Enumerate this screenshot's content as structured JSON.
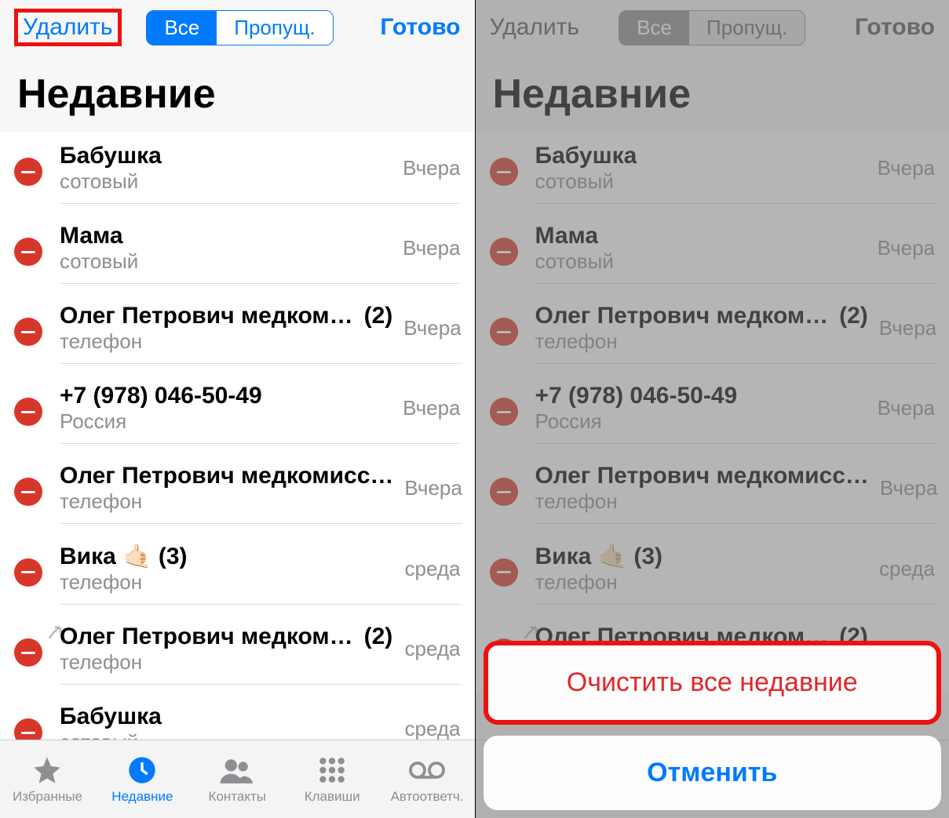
{
  "nav": {
    "delete": "Удалить",
    "done": "Готово",
    "seg_all": "Все",
    "seg_missed": "Пропущ."
  },
  "title": "Недавние",
  "rows": [
    {
      "name": "Бабушка",
      "sub": "сотовый",
      "time": "Вчера",
      "count": "",
      "outgoing": false
    },
    {
      "name": "Мама",
      "sub": "сотовый",
      "time": "Вчера",
      "count": "",
      "outgoing": false
    },
    {
      "name": "Олег Петрович медком…",
      "sub": "телефон",
      "time": "Вчера",
      "count": "(2)",
      "outgoing": false
    },
    {
      "name": "+7 (978) 046-50-49",
      "sub": "Россия",
      "time": "Вчера",
      "count": "",
      "outgoing": false
    },
    {
      "name": "Олег Петрович медкомисс…",
      "sub": "телефон",
      "time": "Вчера",
      "count": "",
      "outgoing": false
    },
    {
      "name": "Вика 🤙🏻 (3)",
      "sub": "телефон",
      "time": "среда",
      "count": "",
      "outgoing": false
    },
    {
      "name": "Олег Петрович медком…",
      "sub": "телефон",
      "time": "среда",
      "count": "(2)",
      "outgoing": true
    },
    {
      "name": "Бабушка",
      "sub": "сотовый",
      "time": "среда",
      "count": "",
      "outgoing": false
    }
  ],
  "tabs": {
    "favorites": "Избранные",
    "recents": "Недавние",
    "contacts": "Контакты",
    "keypad": "Клавиши",
    "voicemail": "Автоответч."
  },
  "sheet": {
    "clear_all": "Очистить все недавние",
    "cancel": "Отменить"
  }
}
